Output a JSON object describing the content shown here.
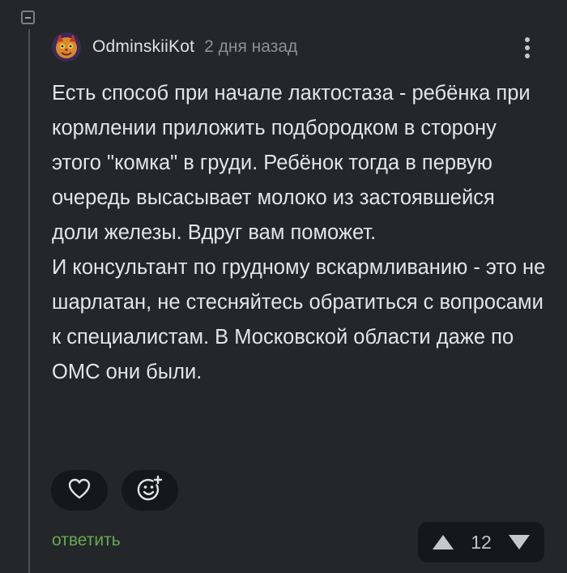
{
  "comment": {
    "author": "OdminskiiKot",
    "timestamp": "2 дня назад",
    "text": "Есть способ при начале лактостаза - ребёнка при кормлении приложить подбородком в сторону этого \"комка\" в груди. Ребёнок тогда в первую очередь высасывает молоко из застоявшейся доли железы. Вдруг вам поможет.\nИ консультант по грудному вскармливанию - это не шарлатан, не стесняйтесь обратиться с вопросами к специалистам. В Московской области даже по ОМС они были.",
    "reply_label": "ответить",
    "rating": "12"
  },
  "icons": {
    "collapse": "collapse-minus-icon",
    "menu": "more-vertical-icon",
    "like": "heart-icon",
    "reaction": "add-emoji-icon",
    "upvote": "triangle-up-icon",
    "downvote": "triangle-down-icon"
  },
  "colors": {
    "background": "#23272a",
    "button_bg": "#15181a",
    "text": "#e4e4e4",
    "muted": "#8b9094",
    "reply": "#6aa84f"
  }
}
